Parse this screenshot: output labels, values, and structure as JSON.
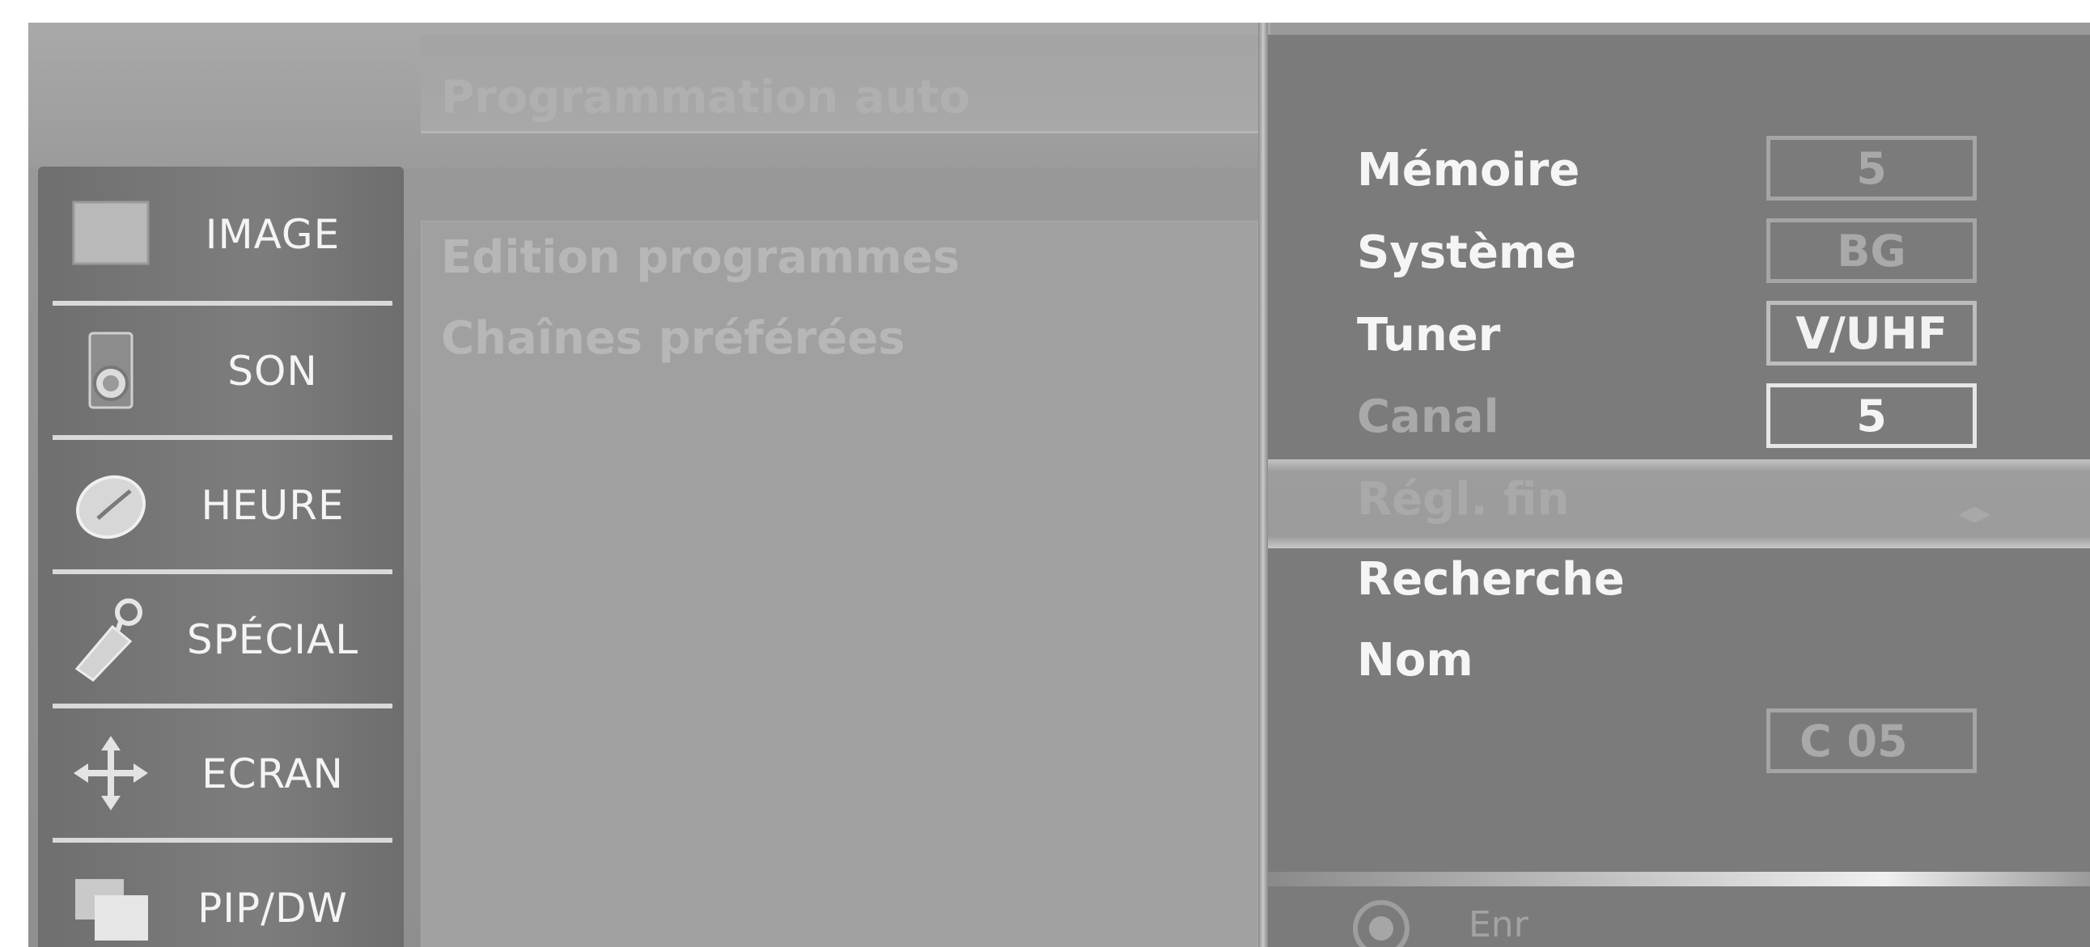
{
  "categories": [
    {
      "label": "IMAGE",
      "icon": "image-icon"
    },
    {
      "label": "SON",
      "icon": "speaker-icon"
    },
    {
      "label": "HEURE",
      "icon": "clock-icon"
    },
    {
      "label": "SPÉCIAL",
      "icon": "tag-icon"
    },
    {
      "label": "ECRAN",
      "icon": "move-arrows-icon"
    },
    {
      "label": "PIP/DW",
      "icon": "pip-icon"
    }
  ],
  "menu": {
    "items": [
      "Programmation auto",
      "Edition programmes",
      "Chaînes préférées"
    ]
  },
  "settings": {
    "memoire": {
      "label": "Mémoire",
      "value": "5"
    },
    "systeme": {
      "label": "Système",
      "value": "BG"
    },
    "tuner": {
      "label": "Tuner",
      "value": "V/UHF"
    },
    "canal": {
      "label": "Canal",
      "value": "5"
    },
    "regl_fin": {
      "label": "Régl. fin",
      "arrows": "◂▸"
    },
    "recherche": {
      "label": "Recherche"
    },
    "nom": {
      "label": "Nom",
      "value": "C 05"
    }
  },
  "footer": {
    "save_label": "Enr"
  }
}
